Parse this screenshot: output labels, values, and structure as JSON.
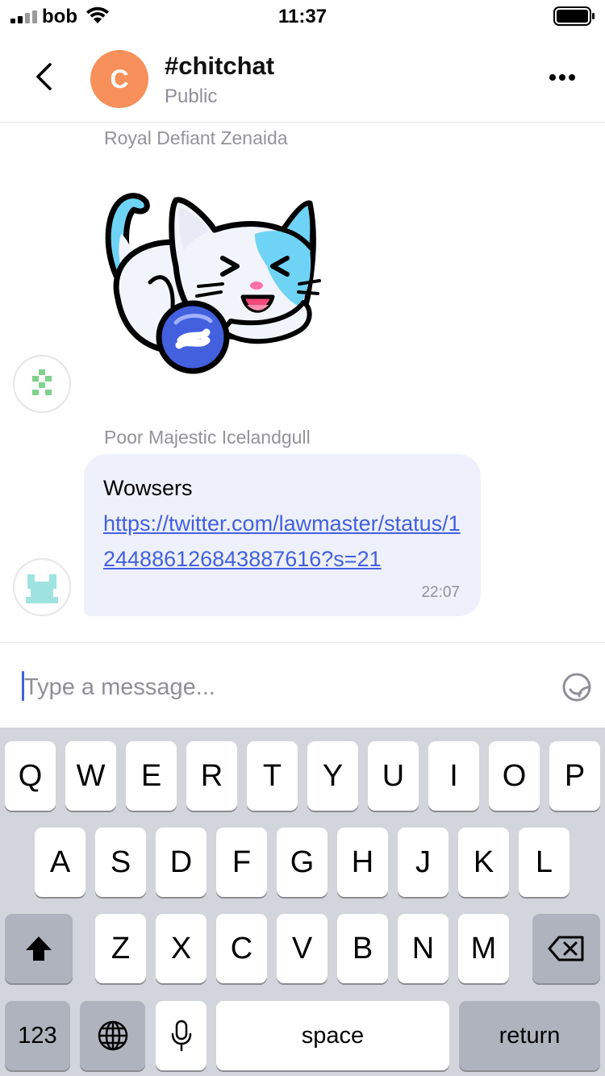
{
  "status_bar": {
    "carrier": "bob",
    "time": "11:37"
  },
  "header": {
    "avatar_letter": "C",
    "channel_name": "#chitchat",
    "channel_type": "Public"
  },
  "messages": [
    {
      "sender": "Royal Defiant Zenaida",
      "kind": "sticker"
    },
    {
      "sender": "Poor Majestic Icelandgull",
      "text": "Wowsers",
      "link": "https://twitter.com/lawmaster/status/1244886126843887616?s=21",
      "time": "22:07"
    }
  ],
  "composer": {
    "placeholder": "Type a message..."
  },
  "keyboard": {
    "row1": [
      "Q",
      "W",
      "E",
      "R",
      "T",
      "Y",
      "U",
      "I",
      "O",
      "P"
    ],
    "row2": [
      "A",
      "S",
      "D",
      "F",
      "G",
      "H",
      "J",
      "K",
      "L"
    ],
    "row3": [
      "Z",
      "X",
      "C",
      "V",
      "B",
      "N",
      "M"
    ],
    "numbers_label": "123",
    "space_label": "space",
    "return_label": "return"
  },
  "colors": {
    "accent": "#4360df",
    "avatar": "#f7905a",
    "bubble": "#eef0fb",
    "keyboard": "#d2d5db"
  }
}
